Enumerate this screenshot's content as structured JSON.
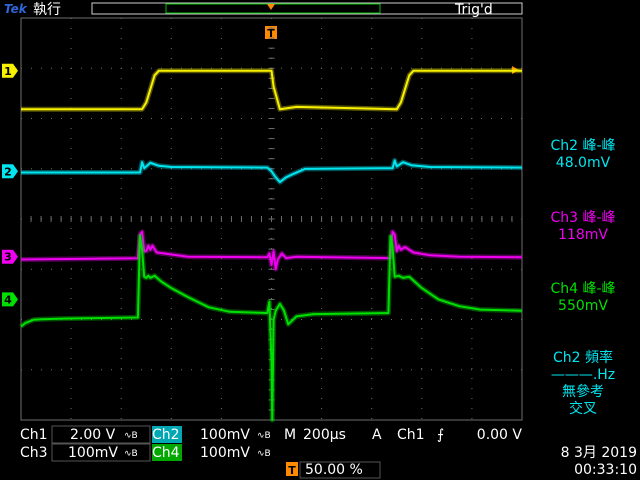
{
  "header": {
    "brand": "Tek",
    "run_state": "執行",
    "trigger_status": "Trig'd",
    "trigger_marker": "T"
  },
  "channel_markers": [
    {
      "label": "1",
      "color": "#f7f100"
    },
    {
      "label": "2",
      "color": "#00e6f0"
    },
    {
      "label": "3",
      "color": "#f000f0"
    },
    {
      "label": "4",
      "color": "#00e000"
    }
  ],
  "measurements": [
    {
      "title": "Ch2 峰-峰",
      "value": "48.0mV",
      "color": "#00e6f0"
    },
    {
      "title": "Ch3 峰-峰",
      "value": "118mV",
      "color": "#f000f0"
    },
    {
      "title": "Ch4 峰-峰",
      "value": "550mV",
      "color": "#00e000"
    },
    {
      "title": "Ch2 頻率",
      "value": "———.Hz",
      "note1": "無參考",
      "note2": "交叉",
      "color": "#00e6f0"
    }
  ],
  "status": {
    "ch1_label": "Ch1",
    "ch1_scale": "2.00 V",
    "ch2_label": "Ch2",
    "ch2_scale": "100mV",
    "ch3_label": "Ch3",
    "ch3_scale": "100mV",
    "ch4_label": "Ch4",
    "ch4_scale": "100mV",
    "bw_symbol": "∿B",
    "timebase_label": "M",
    "timebase": "200µs",
    "trigger_mode": "A",
    "trigger_source": "Ch1",
    "trigger_slope": "⨍",
    "trigger_level": "0.00 V",
    "trigger_position_label": "T",
    "trigger_position": "50.00 %",
    "date": "8 3月  2019",
    "time": "00:33:10"
  },
  "colors": {
    "ch1": "#f7f100",
    "ch2": "#00e6f0",
    "ch3": "#f000f0",
    "ch4": "#00e000",
    "trigger": "#ff8a00",
    "grid": "#6e6e6e"
  },
  "waveforms": {
    "ch1": [
      [
        0,
        -3.3
      ],
      [
        1,
        -3.3
      ],
      [
        2.9,
        -3.3
      ],
      [
        3,
        -3.15
      ],
      [
        3.2,
        -2.55
      ],
      [
        3.3,
        -2.45
      ],
      [
        6,
        -2.45
      ],
      [
        6.05,
        -2.8
      ],
      [
        6.2,
        -3.3
      ],
      [
        6.6,
        -3.25
      ],
      [
        9,
        -3.3
      ],
      [
        9.1,
        -3.15
      ],
      [
        9.3,
        -2.55
      ],
      [
        9.4,
        -2.45
      ],
      [
        12,
        -2.45
      ]
    ],
    "ch2": [
      [
        0,
        -0.02
      ],
      [
        2.85,
        -0.02
      ],
      [
        2.9,
        0.15
      ],
      [
        2.95,
        0.05
      ],
      [
        3.1,
        0.14
      ],
      [
        3.3,
        0.09
      ],
      [
        3.6,
        0.07
      ],
      [
        5.9,
        0.06
      ],
      [
        6.0,
        0.0
      ],
      [
        6.1,
        -0.1
      ],
      [
        6.2,
        -0.18
      ],
      [
        6.35,
        -0.1
      ],
      [
        6.5,
        -0.05
      ],
      [
        6.8,
        0.04
      ],
      [
        8.9,
        0.05
      ],
      [
        8.95,
        0.18
      ],
      [
        9.0,
        0.08
      ],
      [
        9.15,
        0.15
      ],
      [
        9.35,
        0.1
      ],
      [
        9.8,
        0.07
      ],
      [
        12,
        0.06
      ]
    ],
    "ch3": [
      [
        0,
        -0.1
      ],
      [
        2.8,
        -0.06
      ],
      [
        2.85,
        0.8
      ],
      [
        2.9,
        0.9
      ],
      [
        2.95,
        0.2
      ],
      [
        3.0,
        0.2
      ],
      [
        3.05,
        0.4
      ],
      [
        3.1,
        0.25
      ],
      [
        3.15,
        0.4
      ],
      [
        3.25,
        0.15
      ],
      [
        3.5,
        0.1
      ],
      [
        4.0,
        0.0
      ],
      [
        5.9,
        -0.02
      ],
      [
        5.95,
        0.12
      ],
      [
        6.0,
        -0.3
      ],
      [
        6.05,
        0.2
      ],
      [
        6.1,
        -0.45
      ],
      [
        6.15,
        -0.1
      ],
      [
        6.25,
        0.12
      ],
      [
        6.35,
        -0.05
      ],
      [
        6.6,
        0.0
      ],
      [
        8.85,
        -0.05
      ],
      [
        8.9,
        0.9
      ],
      [
        8.95,
        0.8
      ],
      [
        9.0,
        0.2
      ],
      [
        9.05,
        0.4
      ],
      [
        9.1,
        0.25
      ],
      [
        9.2,
        0.35
      ],
      [
        9.4,
        0.15
      ],
      [
        9.8,
        0.05
      ],
      [
        10.5,
        0.0
      ],
      [
        12,
        -0.02
      ]
    ],
    "ch4": [
      [
        0,
        -1.2
      ],
      [
        0.1,
        -1.05
      ],
      [
        0.3,
        -0.9
      ],
      [
        0.5,
        -0.88
      ],
      [
        1,
        -0.85
      ],
      [
        2.8,
        -0.8
      ],
      [
        2.85,
        2.8
      ],
      [
        2.9,
        2.2
      ],
      [
        2.95,
        1.0
      ],
      [
        3.0,
        0.95
      ],
      [
        3.05,
        1.05
      ],
      [
        3.1,
        0.95
      ],
      [
        3.2,
        1.05
      ],
      [
        3.35,
        0.8
      ],
      [
        3.6,
        0.5
      ],
      [
        4.0,
        0.1
      ],
      [
        4.5,
        -0.35
      ],
      [
        5.0,
        -0.55
      ],
      [
        5.9,
        -0.6
      ],
      [
        5.95,
        -0.1
      ],
      [
        6.0,
        -2.8
      ],
      [
        6.02,
        -8.5
      ],
      [
        6.05,
        -0.9
      ],
      [
        6.1,
        -0.5
      ],
      [
        6.2,
        -0.2
      ],
      [
        6.3,
        -0.5
      ],
      [
        6.4,
        -1.1
      ],
      [
        6.6,
        -0.75
      ],
      [
        7.0,
        -0.65
      ],
      [
        8.8,
        -0.6
      ],
      [
        8.85,
        2.8
      ],
      [
        8.9,
        2.3
      ],
      [
        8.95,
        1.0
      ],
      [
        9.05,
        1.05
      ],
      [
        9.15,
        0.95
      ],
      [
        9.3,
        1.0
      ],
      [
        9.6,
        0.5
      ],
      [
        10.0,
        0.0
      ],
      [
        10.5,
        -0.3
      ],
      [
        11.0,
        -0.45
      ],
      [
        12,
        -0.5
      ]
    ]
  }
}
